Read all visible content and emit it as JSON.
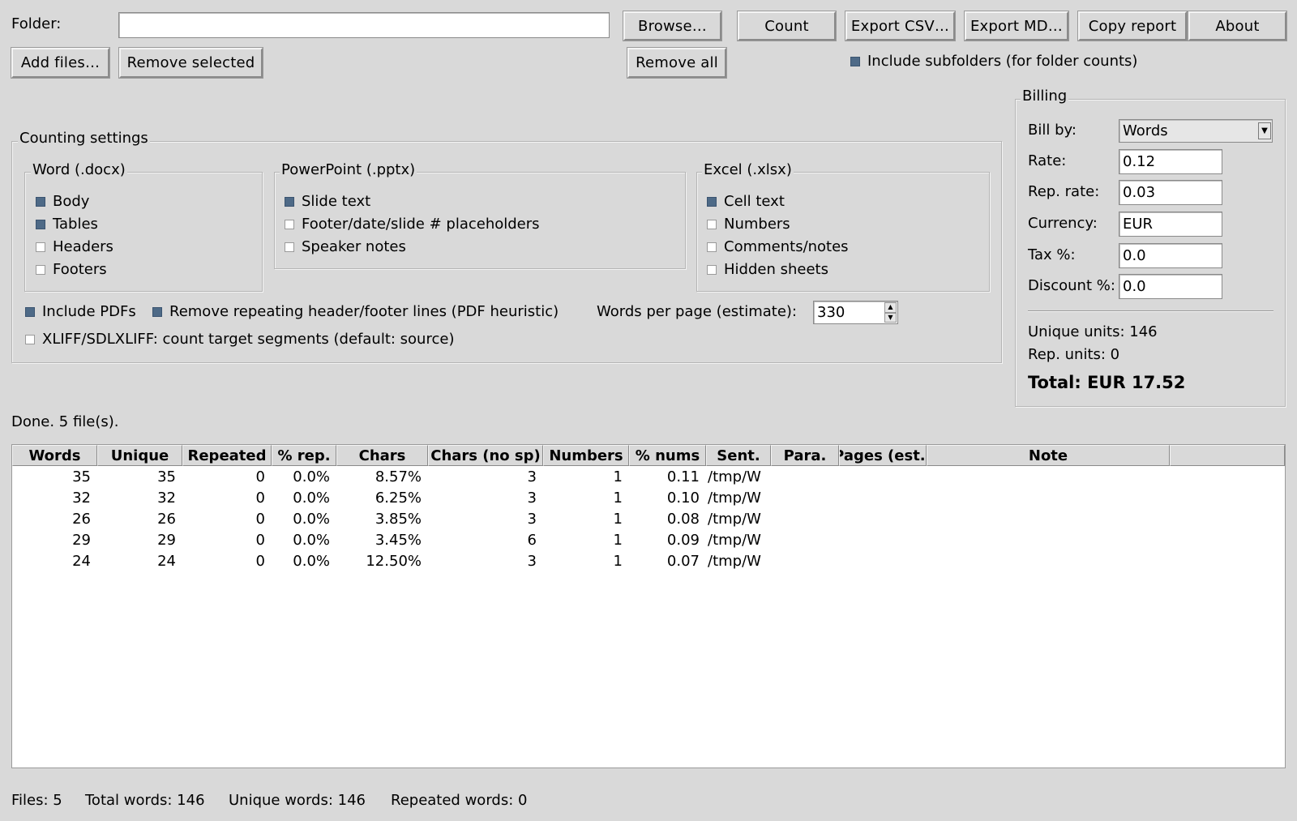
{
  "toolbar": {
    "folder_label": "Folder:",
    "folder_value": "",
    "browse": "Browse…",
    "count": "Count",
    "export_csv": "Export CSV…",
    "export_md": "Export MD…",
    "copy_report": "Copy report",
    "about": "About",
    "add_files": "Add files…",
    "remove_selected": "Remove selected",
    "remove_all": "Remove all",
    "include_subfolders": "Include subfolders (for folder counts)",
    "include_subfolders_checked": true
  },
  "counting": {
    "title": "Counting settings",
    "word": {
      "title": "Word (.docx)",
      "items": [
        {
          "label": "Body",
          "checked": true
        },
        {
          "label": "Tables",
          "checked": true
        },
        {
          "label": "Headers",
          "checked": false
        },
        {
          "label": "Footers",
          "checked": false
        }
      ]
    },
    "pptx": {
      "title": "PowerPoint (.pptx)",
      "items": [
        {
          "label": "Slide text",
          "checked": true
        },
        {
          "label": "Footer/date/slide # placeholders",
          "checked": false
        },
        {
          "label": "Speaker notes",
          "checked": false
        }
      ]
    },
    "excel": {
      "title": "Excel (.xlsx)",
      "items": [
        {
          "label": "Cell text",
          "checked": true
        },
        {
          "label": "Numbers",
          "checked": false
        },
        {
          "label": "Comments/notes",
          "checked": false
        },
        {
          "label": "Hidden sheets",
          "checked": false
        }
      ]
    },
    "include_pdfs": "Include PDFs",
    "remove_repeating": "Remove repeating header/footer lines (PDF heuristic)",
    "words_per_page_label": "Words per page (estimate):",
    "words_per_page": "330",
    "xliff": "XLIFF/SDLXLIFF: count target segments (default: source)"
  },
  "billing": {
    "title": "Billing",
    "bill_by_label": "Bill by:",
    "bill_by": "Words",
    "rate_label": "Rate:",
    "rate": "0.12",
    "rep_rate_label": "Rep. rate:",
    "rep_rate": "0.03",
    "currency_label": "Currency:",
    "currency": "EUR",
    "tax_label": "Tax %:",
    "tax": "0.0",
    "discount_label": "Discount %:",
    "discount": "0.0",
    "unique_units": "Unique units: 146",
    "rep_units": "Rep. units: 0",
    "total": "Total: EUR 17.52"
  },
  "status": "Done. 5 file(s).",
  "table": {
    "headers": [
      "Words",
      "Unique",
      "Repeated",
      "% rep.",
      "Chars",
      "Chars (no sp)",
      "Numbers",
      "% nums",
      "Sent.",
      "Para.",
      "Pages (est.)",
      "Note"
    ],
    "rows": [
      [
        "35",
        "35",
        "0",
        "0.0%",
        "8.57%",
        "3",
        "1",
        "0.11",
        "/tmp/W"
      ],
      [
        "32",
        "32",
        "0",
        "0.0%",
        "6.25%",
        "3",
        "1",
        "0.10",
        "/tmp/W"
      ],
      [
        "26",
        "26",
        "0",
        "0.0%",
        "3.85%",
        "3",
        "1",
        "0.08",
        "/tmp/W"
      ],
      [
        "29",
        "29",
        "0",
        "0.0%",
        "3.45%",
        "6",
        "1",
        "0.09",
        "/tmp/W"
      ],
      [
        "24",
        "24",
        "0",
        "0.0%",
        "12.50%",
        "3",
        "1",
        "0.07",
        "/tmp/W"
      ]
    ]
  },
  "footer": {
    "files": "Files: 5",
    "total_words": "Total words: 146",
    "unique_words": "Unique words: 146",
    "repeated_words": "Repeated words: 0"
  }
}
